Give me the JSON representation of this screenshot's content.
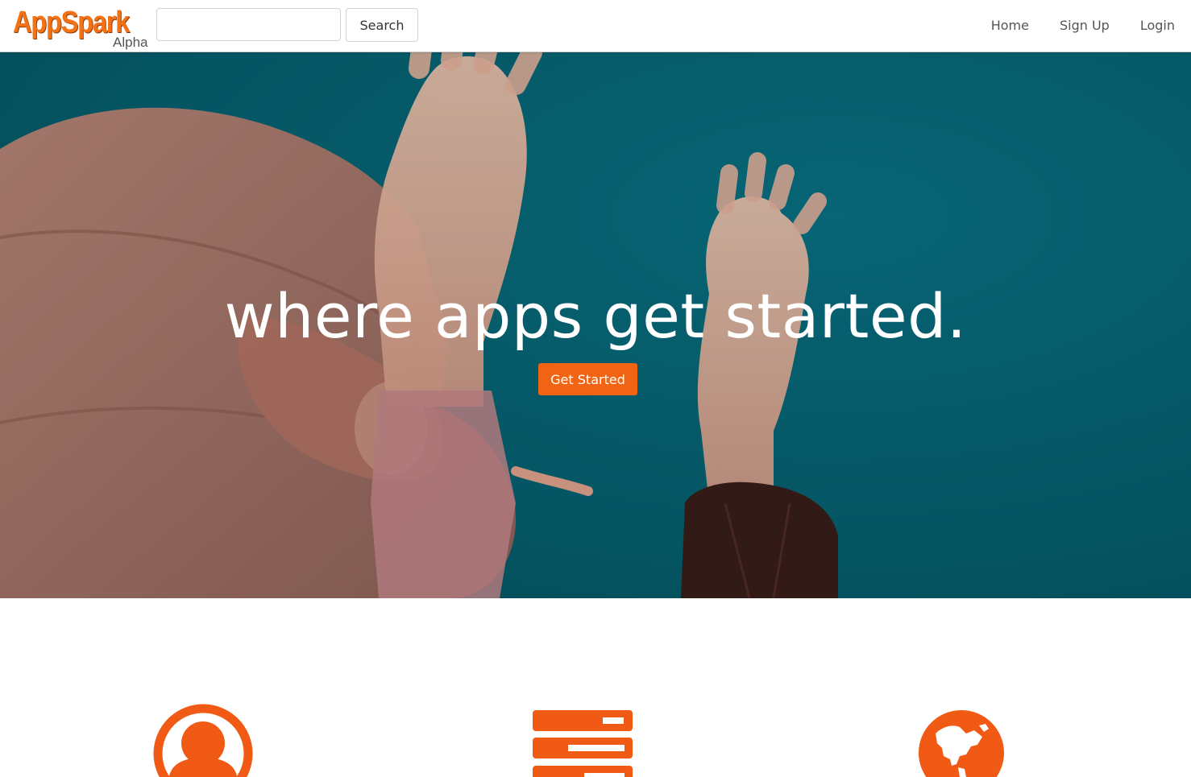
{
  "brand": {
    "name": "AppSpark",
    "tag": "Alpha"
  },
  "search": {
    "placeholder": "",
    "value": "",
    "button_label": "Search"
  },
  "nav": {
    "items": [
      {
        "label": "Home"
      },
      {
        "label": "Sign Up"
      },
      {
        "label": "Login"
      }
    ]
  },
  "hero": {
    "title": "where apps get started.",
    "cta_label": "Get Started"
  },
  "features": {
    "icons": [
      "user-circle-icon",
      "server-icon",
      "globe-icon"
    ]
  },
  "colors": {
    "accent": "#f06414",
    "brand_orange": "#f47216",
    "hero_teal": "#0a6a7a",
    "nav_text": "#555555"
  }
}
